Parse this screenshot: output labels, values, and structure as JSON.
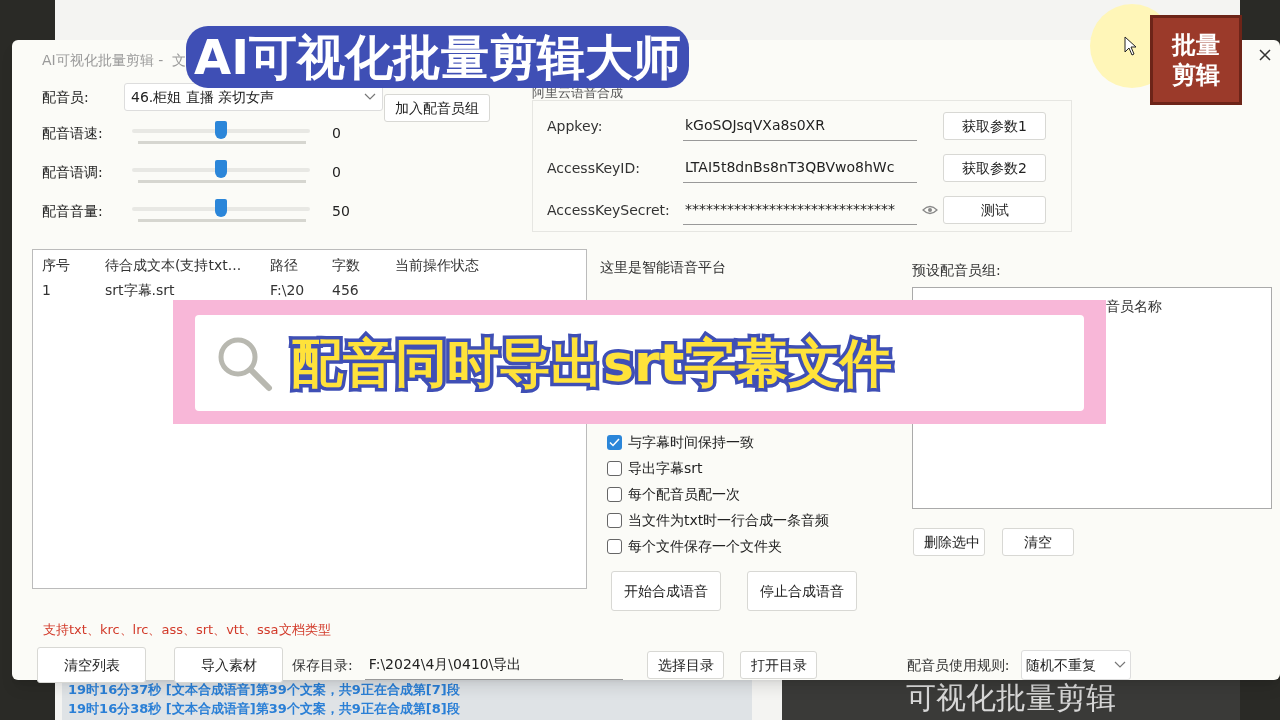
{
  "video_title": "AI可视化批量剪辑大师",
  "logo": {
    "lines": [
      "批量",
      "剪辑"
    ]
  },
  "caption": "配音同时导出srt字幕文件",
  "window": {
    "title": "AI可视化批量剪辑 -  文"
  },
  "voice": {
    "label": "配音员:",
    "value": "46.柜姐 直播 亲切女声"
  },
  "add_group_button": "加入配音员组",
  "sliders": [
    {
      "label": "配音语速:",
      "level": 0.5,
      "reading": "0"
    },
    {
      "label": "配音语调:",
      "level": 0.5,
      "reading": "0"
    },
    {
      "label": "配音音量:",
      "level": 0.5,
      "reading": "50"
    }
  ],
  "aliyun": {
    "title": "阿里云语音合成",
    "fields": [
      {
        "kind": "plain",
        "label": "Appkey:",
        "value": "kGoSOJsqVXa8s0XR",
        "button": "获取参数1"
      },
      {
        "kind": "plain",
        "label": "AccessKeyID:",
        "value": "LTAI5t8dnBs8nT3QBVwo8hWc",
        "button": "获取参数2"
      },
      {
        "kind": "secret",
        "label": "AccessKeySecret:",
        "value": "******************************",
        "button": "测试"
      }
    ]
  },
  "table": {
    "columns": [
      "序号",
      "待合成文本(支持txt...",
      "路径",
      "字数",
      "当前操作状态"
    ],
    "rows": [
      {
        "cells": [
          "1",
          "srt字幕.srt",
          "F:\\20",
          "456"
        ]
      }
    ]
  },
  "platform_note": "这里是智能语音平台",
  "options": [
    {
      "label": "与字幕时间保持一致",
      "checked": true
    },
    {
      "label": "导出字幕srt",
      "checked": false
    },
    {
      "label": "每个配音员配一次",
      "checked": false
    },
    {
      "label": "当文件为txt时一行合成一条音频",
      "checked": false
    },
    {
      "label": "每个文件保存一个文件夹",
      "checked": false
    }
  ],
  "actions": [
    "开始合成语音",
    "停止合成语音"
  ],
  "preset_group": {
    "label": "预设配音员组:",
    "header": "音员名称",
    "buttons": [
      "删除选中",
      "清空"
    ]
  },
  "supported_types": "支持txt、krc、lrc、ass、srt、vtt、ssa文档类型",
  "bottom": {
    "buttons": [
      "清空列表",
      "导入素材"
    ],
    "save_label": "保存目录:",
    "save_path": "F:\\2024\\4月\\0410\\导出",
    "dir_buttons": [
      "选择目录",
      "打开目录"
    ]
  },
  "rule": {
    "label": "配音员使用规则:",
    "value": "随机不重复"
  },
  "log": [
    "19时16分37秒  [文本合成语音]第39个文案，共9正在合成第[7]段",
    "19时16分38秒  [文本合成语音]第39个文案，共9正在合成第[8]段"
  ],
  "background_panel": "可视化批量剪辑"
}
